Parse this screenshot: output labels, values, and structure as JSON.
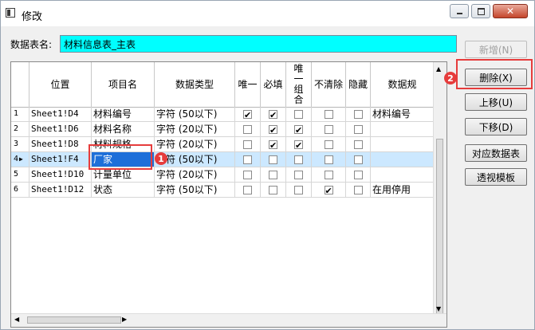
{
  "window": {
    "title": "修改"
  },
  "form": {
    "table_name_label": "数据表名:",
    "table_name_value": "材料信息表_主表"
  },
  "grid": {
    "columns": [
      "",
      "位置",
      "项目名",
      "数据类型",
      "唯一",
      "必填",
      "唯一组合",
      "不清除",
      "隐藏",
      "数据规"
    ],
    "rows": [
      {
        "index": "1",
        "position": "Sheet1!D4",
        "name": "材料编号",
        "type": "字符 (50以下)",
        "unique": true,
        "required": true,
        "unique_combo": false,
        "no_clear": false,
        "hidden": false,
        "rule": "材料编号",
        "selected": false
      },
      {
        "index": "2",
        "position": "Sheet1!D6",
        "name": "材料名称",
        "type": "字符 (20以下)",
        "unique": false,
        "required": true,
        "unique_combo": true,
        "no_clear": false,
        "hidden": false,
        "rule": "",
        "selected": false
      },
      {
        "index": "3",
        "position": "Sheet1!D8",
        "name": "材料规格",
        "type": "字符 (20以下)",
        "unique": false,
        "required": true,
        "unique_combo": true,
        "no_clear": false,
        "hidden": false,
        "rule": "",
        "selected": false
      },
      {
        "index": "4",
        "position": "Sheet1!F4",
        "name": "厂家",
        "type": "字符 (50以下)",
        "unique": false,
        "required": false,
        "unique_combo": false,
        "no_clear": false,
        "hidden": false,
        "rule": "",
        "selected": true
      },
      {
        "index": "5",
        "position": "Sheet1!D10",
        "name": "计量单位",
        "type": "字符 (20以下)",
        "unique": false,
        "required": false,
        "unique_combo": false,
        "no_clear": false,
        "hidden": false,
        "rule": "",
        "selected": false
      },
      {
        "index": "6",
        "position": "Sheet1!D12",
        "name": "状态",
        "type": "字符 (50以下)",
        "unique": false,
        "required": false,
        "unique_combo": false,
        "no_clear": true,
        "hidden": false,
        "rule": "在用停用",
        "selected": false
      }
    ]
  },
  "buttons": {
    "add": "新增(N)",
    "delete": "删除(X)",
    "move_up": "上移(U)",
    "move_down": "下移(D)",
    "mapping_table": "对应数据表",
    "pivot_template": "透视模板"
  },
  "annotations": {
    "badge_1": "1",
    "badge_2": "2"
  },
  "colors": {
    "name_field_bg": "#00ffff",
    "highlight": "#e63c3c",
    "selected_row": "#cce8ff",
    "edit_cell": "#1e6fd9"
  },
  "icons": {
    "app": "app-window-icon",
    "minimize": "minimize-icon",
    "maximize": "maximize-icon",
    "close": "close-icon"
  }
}
